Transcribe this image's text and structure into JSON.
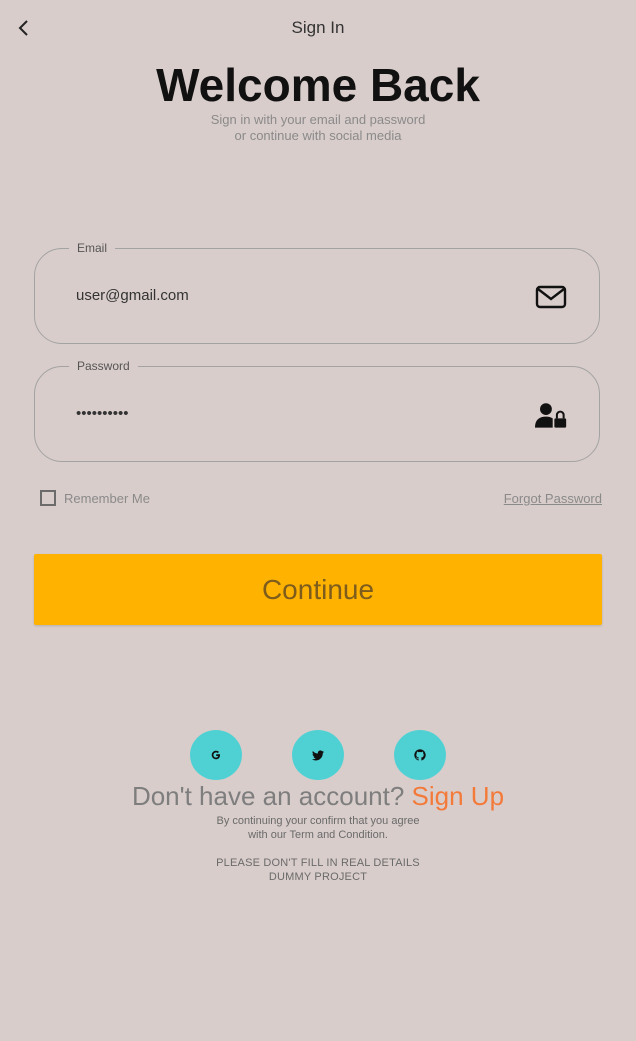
{
  "header": {
    "title": "Sign In"
  },
  "welcome": {
    "heading": "Welcome Back",
    "subtitle_line1": "Sign in with your email and password",
    "subtitle_line2": "or continue with social media"
  },
  "email": {
    "label": "Email",
    "value": "user@gmail.com",
    "icon": "envelope-icon"
  },
  "password": {
    "label": "Password",
    "value": "••••••••••",
    "icon": "user-lock-icon"
  },
  "remember": {
    "label": "Remember Me",
    "checked": false
  },
  "forgot": {
    "label": "Forgot Password"
  },
  "continue": {
    "label": "Continue"
  },
  "social": [
    {
      "icon": "google-icon"
    },
    {
      "icon": "twitter-icon"
    },
    {
      "icon": "github-icon"
    }
  ],
  "signup": {
    "prompt": "Don't have an account? ",
    "link": "Sign Up"
  },
  "terms": {
    "line1": "By continuing your confirm that you agree",
    "line2": "with our Term and Condition."
  },
  "notice": {
    "line1": "PLEASE DON'T FILL IN REAL DETAILS",
    "line2": "DUMMY PROJECT"
  },
  "colors": {
    "background": "#d8cdcb",
    "accent": "#ffb300",
    "social": "#4fd1d4",
    "link": "#f37a39"
  }
}
